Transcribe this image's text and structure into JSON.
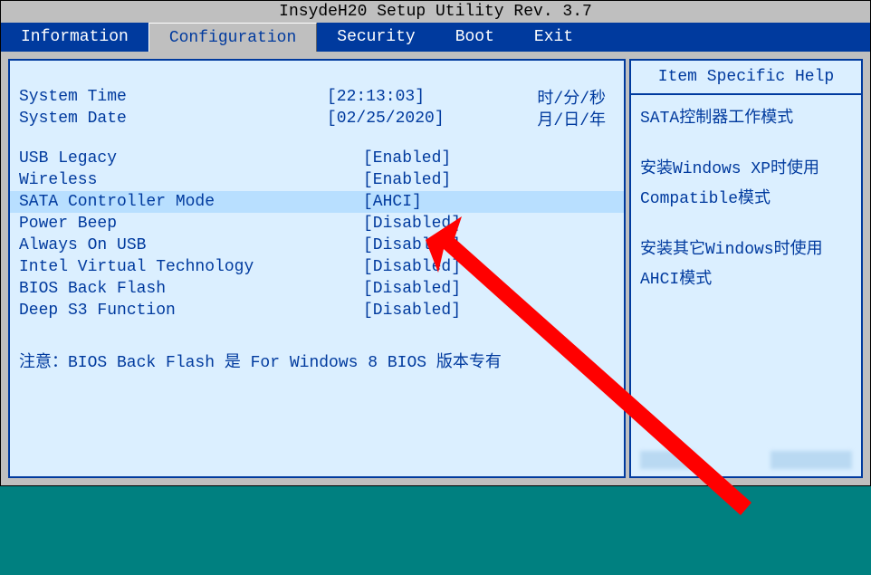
{
  "title": "InsydeH20 Setup Utility Rev. 3.7",
  "tabs": {
    "information": "Information",
    "configuration": "Configuration",
    "security": "Security",
    "boot": "Boot",
    "exit": "Exit"
  },
  "settings": {
    "system_time": {
      "label": "System Time",
      "value": "[22:13:03]",
      "hint": "时/分/秒"
    },
    "system_date": {
      "label": "System Date",
      "value": "[02/25/2020]",
      "hint": "月/日/年"
    },
    "usb_legacy": {
      "label": "USB Legacy",
      "value": "[Enabled]"
    },
    "wireless": {
      "label": "Wireless",
      "value": "[Enabled]"
    },
    "sata_controller_mode": {
      "label": "SATA Controller Mode",
      "value": "[AHCI]"
    },
    "power_beep": {
      "label": "Power Beep",
      "value": "[Disabled]"
    },
    "always_on_usb": {
      "label": "Always On USB",
      "value": "[Disabled]"
    },
    "intel_virtual_technology": {
      "label": "Intel Virtual Technology",
      "value": "[Disabled]"
    },
    "bios_back_flash": {
      "label": "BIOS Back Flash",
      "value": "[Disabled]"
    },
    "deep_s3_function": {
      "label": "Deep S3 Function",
      "value": "[Disabled]"
    }
  },
  "note": "注意：BIOS Back Flash 是 For Windows 8 BIOS 版本专有",
  "help": {
    "title": "Item Specific Help",
    "line1": "SATA控制器工作模式",
    "line2": "安装Windows XP时使用Compatible模式",
    "line3": "安装其它Windows时使用AHCI模式"
  }
}
